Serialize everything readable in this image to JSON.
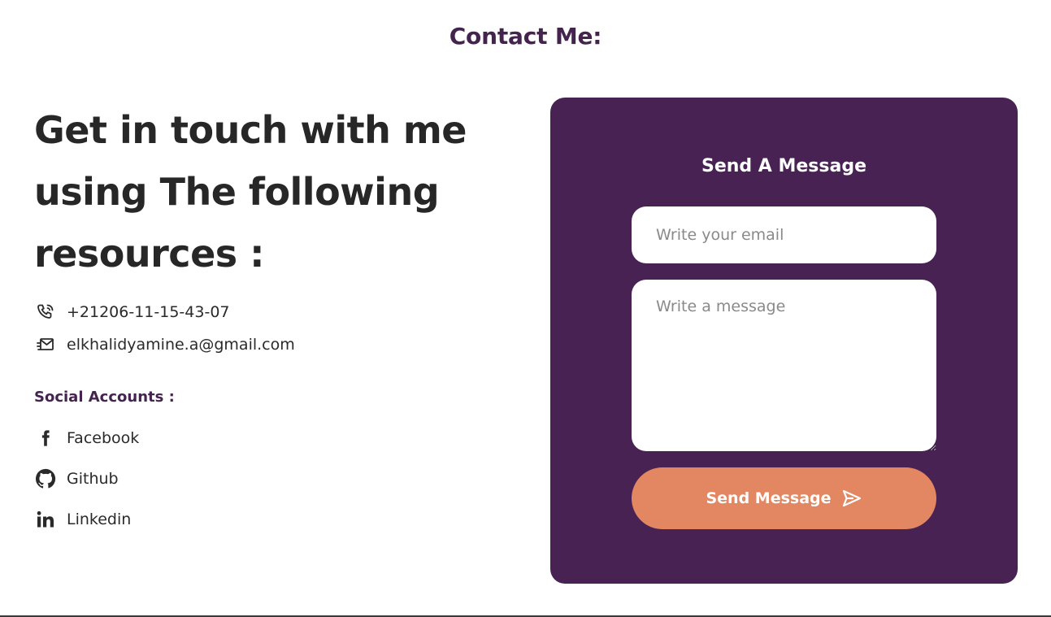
{
  "section_title": "Contact Me:",
  "headline": "Get in touch with me using The following resources :",
  "contacts": [
    {
      "icon": "phone-icon",
      "text": "+21206-11-15-43-07"
    },
    {
      "icon": "email-icon",
      "text": "elkhalidyamine.a@gmail.com"
    }
  ],
  "social": {
    "title": "Social Accounts :",
    "items": [
      {
        "icon": "facebook-icon",
        "label": "Facebook"
      },
      {
        "icon": "github-icon",
        "label": "Github"
      },
      {
        "icon": "linkedin-icon",
        "label": "Linkedin"
      }
    ]
  },
  "form": {
    "title": "Send A Message",
    "email_placeholder": "Write your email",
    "message_placeholder": "Write a message",
    "send_label": "Send Message",
    "send_icon": "send-icon"
  },
  "colors": {
    "brand_purple": "#472253",
    "title_purple": "#45234f",
    "accent_orange": "#e38762",
    "text_dark": "#272727"
  }
}
